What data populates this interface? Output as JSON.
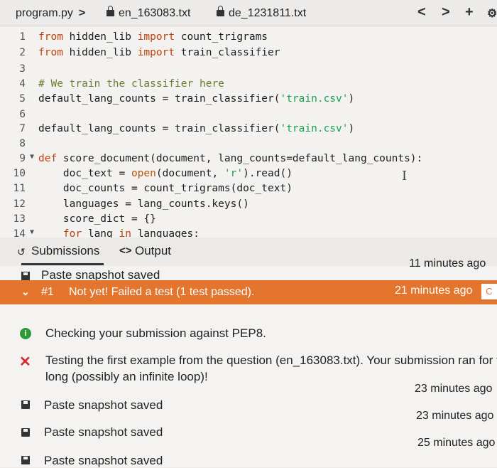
{
  "tabbar": {
    "file_tab": "program.py",
    "file_tab_chevron": ">",
    "tab2": "en_163083.txt",
    "tab3": "de_1231811.txt",
    "prev_btn": "<",
    "next_btn": ">",
    "add_btn": "+"
  },
  "editor": {
    "lines": [
      {
        "num": "1"
      },
      {
        "num": "2"
      },
      {
        "num": "3"
      },
      {
        "num": "4"
      },
      {
        "num": "5"
      },
      {
        "num": "6"
      },
      {
        "num": "7"
      },
      {
        "num": "8"
      },
      {
        "num": "9"
      },
      {
        "num": "10"
      },
      {
        "num": "11"
      },
      {
        "num": "12"
      },
      {
        "num": "13"
      },
      {
        "num": "14"
      }
    ],
    "fold_marker": "▼",
    "code": {
      "l1_from": "from",
      "l1_mod": " hidden_lib ",
      "l1_import": "import",
      "l1_name": " count_trigrams",
      "l2_from": "from",
      "l2_mod": " hidden_lib ",
      "l2_import": "import",
      "l2_name": " train_classifier",
      "l4_comment": "# We train the classifier here",
      "l5_pre": "default_lang_counts = train_classifier(",
      "l5_str": "'train.csv'",
      "l5_post": ")",
      "l7_pre": "default_lang_counts = train_classifier(",
      "l7_str": "'train.csv'",
      "l7_post": ")",
      "l9_def": "def",
      "l9_rest": " score_document(document, lang_counts=default_lang_counts):",
      "l10_pre": "    doc_text = ",
      "l10_fn": "open",
      "l10_mid": "(document, ",
      "l10_str": "'r'",
      "l10_post": ").read()",
      "l11": "    doc_counts = count_trigrams(doc_text)",
      "l12": "    languages = lang_counts.keys()",
      "l13": "    score_dict = {}",
      "l14_for": "    for",
      "l14_mid": " lang ",
      "l14_in": "in",
      "l14_post": " languages:"
    },
    "cursor_glyph": "I"
  },
  "panel_tabs": {
    "submissions": "Submissions",
    "output": "Output"
  },
  "feed": {
    "snap1_label": "Paste snapshot saved",
    "snap1_time": "11 minutes ago",
    "fail_check": "✓",
    "fail_id": "#1",
    "fail_text": "Not yet! Failed a test (1 test passed).",
    "fail_time": "21 minutes ago",
    "fail_btn": "C",
    "info_text": "Checking your submission against PEP8.",
    "error_line1": "Testing the first example from the question (en_163083.txt). Your submission ran for t",
    "error_line2": "long (possibly an infinite loop)!",
    "snap2_label": "Paste snapshot saved",
    "snap2_time": "23 minutes ago",
    "snap3_label": "Paste snapshot saved",
    "snap3_time": "23 minutes ago",
    "snap4_label": "Paste snapshot saved",
    "snap4_time": "25 minutes ago"
  }
}
